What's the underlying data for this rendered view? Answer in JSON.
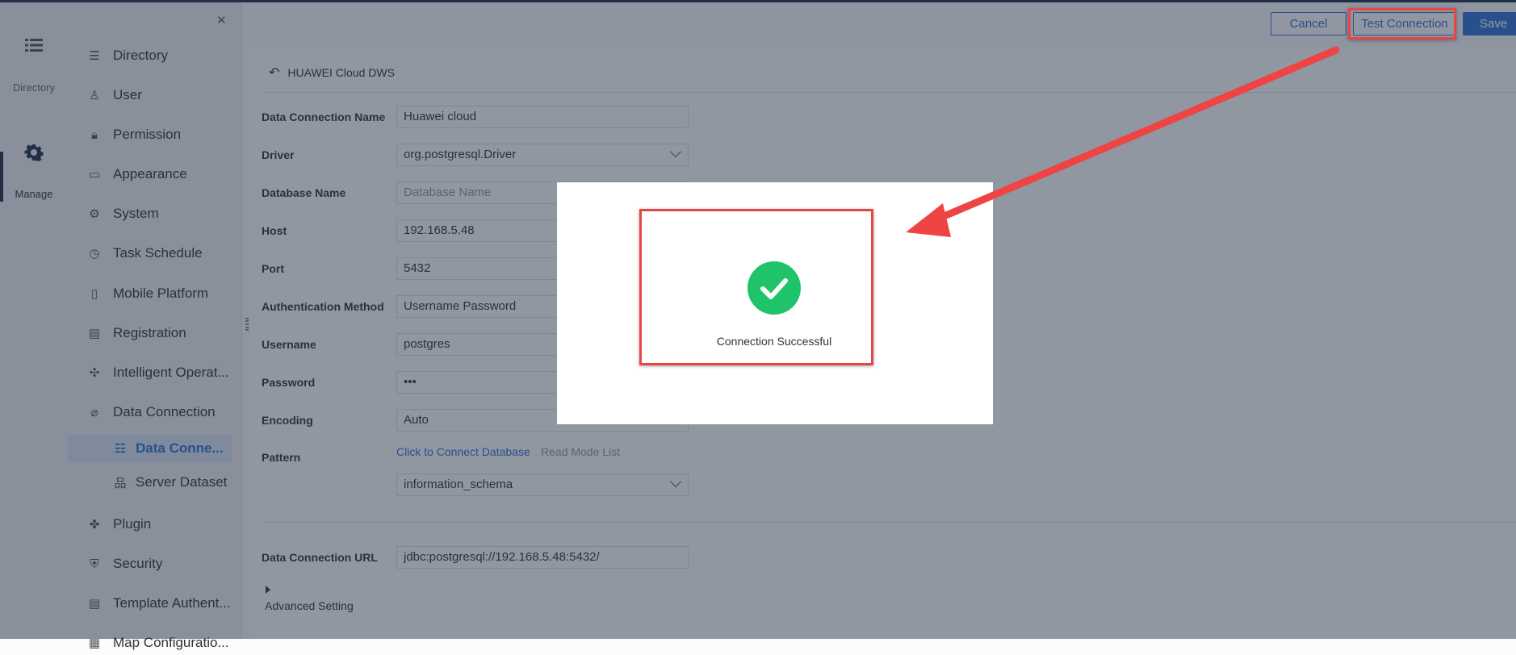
{
  "rail": {
    "items": [
      {
        "label": "Directory",
        "icon": "list-icon"
      },
      {
        "label": "Manage",
        "icon": "gear-icon"
      }
    ]
  },
  "sidebar": {
    "items": [
      {
        "label": "Directory",
        "icon": "directory-icon"
      },
      {
        "label": "User",
        "icon": "user-icon"
      },
      {
        "label": "Permission",
        "icon": "lock-icon"
      },
      {
        "label": "Appearance",
        "icon": "paint-roller-icon"
      },
      {
        "label": "System",
        "icon": "settings-icon"
      },
      {
        "label": "Task Schedule",
        "icon": "timer-icon"
      },
      {
        "label": "Mobile Platform",
        "icon": "tablet-icon"
      },
      {
        "label": "Registration",
        "icon": "registration-icon"
      },
      {
        "label": "Intelligent Operat...",
        "icon": "network-icon"
      },
      {
        "label": "Data Connection",
        "icon": "paperclip-icon"
      },
      {
        "label": "Data Conne...",
        "icon": "database-icon"
      },
      {
        "label": "Server Dataset",
        "icon": "server-dataset-icon"
      },
      {
        "label": "Plugin",
        "icon": "puzzle-icon"
      },
      {
        "label": "Security",
        "icon": "shield-icon"
      },
      {
        "label": "Template Authent...",
        "icon": "template-icon"
      },
      {
        "label": "Map Configuratio...",
        "icon": "map-icon"
      }
    ]
  },
  "toolbar": {
    "cancel": "Cancel",
    "test": "Test Connection",
    "save": "Save"
  },
  "header": {
    "title": "HUAWEI Cloud DWS"
  },
  "form": {
    "name_label": "Data Connection Name",
    "name_value": "Huawei cloud",
    "driver_label": "Driver",
    "driver_value": "org.postgresql.Driver",
    "db_label": "Database Name",
    "db_placeholder": "Database Name",
    "host_label": "Host",
    "host_value": "192.168.5.48",
    "port_label": "Port",
    "port_value": "5432",
    "auth_label": "Authentication Method",
    "auth_value": "Username Password",
    "user_label": "Username",
    "user_value": "postgres",
    "pass_label": "Password",
    "pass_value": "•••",
    "enc_label": "Encoding",
    "enc_value": "Auto",
    "pattern_label": "Pattern",
    "connect_link": "Click to Connect Database",
    "read_mode": "Read Mode List",
    "pattern_value": "information_schema",
    "url_label": "Data Connection URL",
    "url_value": "jdbc:postgresql://192.168.5.48:5432/",
    "advanced": "Advanced Setting"
  },
  "modal": {
    "message": "Connection Successful",
    "accent": "#1fc46a"
  },
  "annotation": {
    "color": "#e84646"
  }
}
